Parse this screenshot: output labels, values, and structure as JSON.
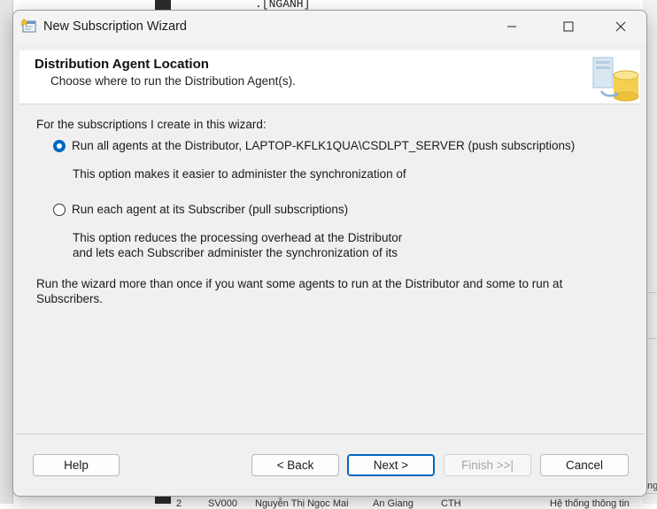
{
  "background": {
    "code_fragment": ".[NGANH]",
    "right_fragment": "ng",
    "grid_fragments": [
      "2",
      "SV000",
      "Nguyễn Thị Ngọc Mai",
      "An Giang",
      "CTH",
      "Hệ thống thông tin"
    ]
  },
  "window": {
    "title": "New Subscription Wizard",
    "icon": "wizard-icon"
  },
  "header": {
    "title": "Distribution Agent Location",
    "subtitle": "Choose where to run the Distribution Agent(s)."
  },
  "content": {
    "intro": "For the subscriptions I create in this wizard:",
    "options": [
      {
        "label": "Run all agents at the Distributor, LAPTOP-KFLK1QUA\\CSDLPT_SERVER (push subscriptions)",
        "description": [
          "This option makes it easier to administer the synchronization of"
        ],
        "selected": true
      },
      {
        "label": "Run each agent at its Subscriber (pull subscriptions)",
        "description": [
          "This option reduces the processing overhead at the Distributor",
          "and lets each Subscriber administer the synchronization of its"
        ],
        "selected": false
      }
    ],
    "note_lines": [
      "Run the wizard more than once if you want some agents to run at the Distributor and some to run at",
      "Subscribers."
    ]
  },
  "buttons": {
    "help": "Help",
    "back": "< Back",
    "next": "Next >",
    "finish": "Finish >>|",
    "cancel": "Cancel"
  },
  "colors": {
    "accent": "#0067c0",
    "dialog_bg": "#f0f0f0",
    "header_bg": "#ffffff"
  }
}
